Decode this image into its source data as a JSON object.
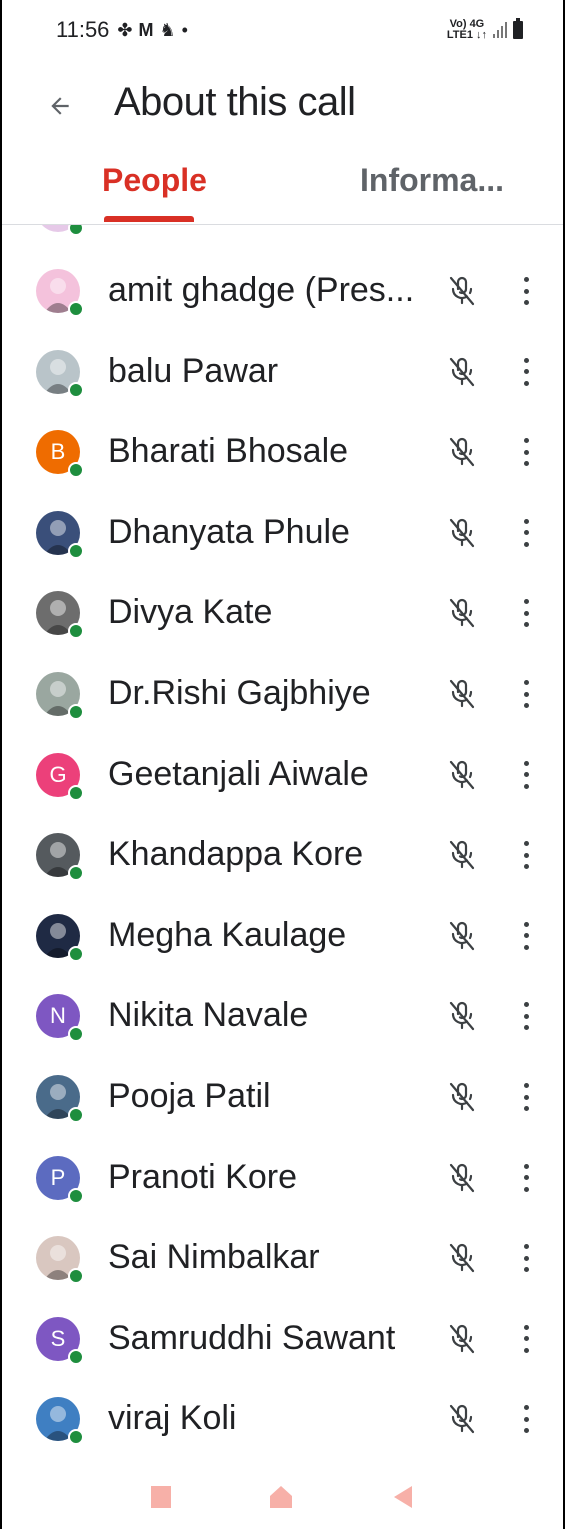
{
  "status": {
    "time": "11:56",
    "icons": [
      "pinwheel-icon",
      "gmail-icon",
      "notification-icon"
    ],
    "dot": "•",
    "net_top": "Vo) 4G",
    "net_bottom": "LTE1 ↓↑"
  },
  "header": {
    "title": "About this call"
  },
  "tabs": [
    {
      "label": "People",
      "active": true
    },
    {
      "label": "Informa..."
    }
  ],
  "participants": [
    {
      "name": "amit ghadge (Pres...",
      "avatar": "photo",
      "color": "#f4c2dc"
    },
    {
      "name": "balu Pawar",
      "avatar": "photo",
      "color": "#b9c4c9"
    },
    {
      "name": "Bharati Bhosale",
      "avatar": "letter",
      "letter": "B",
      "color": "#ef6c00"
    },
    {
      "name": "Dhanyata Phule",
      "avatar": "photo",
      "color": "#3a4f7a"
    },
    {
      "name": "Divya Kate",
      "avatar": "photo",
      "color": "#6d6d6d"
    },
    {
      "name": "Dr.Rishi Gajbhiye",
      "avatar": "photo",
      "color": "#9aa7a0"
    },
    {
      "name": "Geetanjali Aiwale",
      "avatar": "letter",
      "letter": "G",
      "color": "#ec407a"
    },
    {
      "name": "Khandappa Kore",
      "avatar": "photo",
      "color": "#555a5e"
    },
    {
      "name": "Megha Kaulage",
      "avatar": "photo",
      "color": "#1f2a44"
    },
    {
      "name": "Nikita Navale",
      "avatar": "letter",
      "letter": "N",
      "color": "#7e57c2"
    },
    {
      "name": "Pooja Patil",
      "avatar": "photo",
      "color": "#4a6b8a"
    },
    {
      "name": "Pranoti Kore",
      "avatar": "letter",
      "letter": "P",
      "color": "#5c6bc0"
    },
    {
      "name": "Sai Nimbalkar",
      "avatar": "photo",
      "color": "#d9c7c0"
    },
    {
      "name": "Samruddhi Sawant",
      "avatar": "letter",
      "letter": "S",
      "color": "#7e57c2"
    },
    {
      "name": "viraj Koli",
      "avatar": "photo",
      "color": "#3f7fc2"
    }
  ],
  "colors": {
    "accent": "#d93025",
    "presence": "#1e8e3e"
  }
}
